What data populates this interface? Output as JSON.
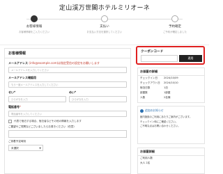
{
  "header": {
    "hotel_name": "定山渓万世閣ホテルミリオーネ"
  },
  "steps": [
    {
      "title": "お客様情報",
      "desc": "お客様情報をご入力ください",
      "active": true
    },
    {
      "title": "支払い",
      "desc": "お支払い方法を選択してください",
      "active": false
    },
    {
      "title": "予約確定",
      "desc": "ご予約が確定しました",
      "active": false
    }
  ],
  "form": {
    "title": "お客様情報",
    "email_label": "メールアドレス",
    "email_note": "(info@example.com)は指定受信の設定をお願いします",
    "email_placeholder": "メールアドレスを入力してください",
    "email_confirm_label": "メールアドレス確認用",
    "email_confirm_placeholder": "もう一度メールアドレスを入力してください",
    "sei_label": "せい",
    "sei_placeholder": "ひらがなを入力",
    "mei_label": "めい",
    "mei_placeholder": "ひらがなを入力",
    "phone_label": "電話番号",
    "phone_placeholder": "電話番号を入力してください",
    "checkbox_label": "代表で宿泊する場合、宿泊者などその他の情報を入力します",
    "notes_label": "ご要望やご質問などございましたらお書きください（任意）",
    "arrival_label": "ご到着予定時刻",
    "arrival_value": "未選択",
    "required_mark": "*"
  },
  "coupon": {
    "label": "クーポンコード",
    "input_placeholder": "",
    "apply_label": "適用"
  },
  "summary": {
    "title": "お部屋の詳細",
    "rows": [
      {
        "k": "チェックイン日",
        "v": "2024/10/09"
      },
      {
        "k": "チェックアウト日",
        "v": "2024/10/10"
      },
      {
        "k": "宿泊日数",
        "v": "1泊"
      },
      {
        "k": "部屋数",
        "v": "1部屋"
      },
      {
        "k": "人数",
        "v": "2名様"
      }
    ]
  },
  "info": {
    "title": "追加のお知らせ",
    "lines": [
      "館内施設のご利用にあたりご案内がございます。",
      "チェックイン時にご確認ください。",
      "ご不明な点はお問い合わせください。"
    ]
  },
  "bottom": {
    "title": "お部屋詳細",
    "line": "ご利用人数",
    "sub": "大人 2名"
  }
}
